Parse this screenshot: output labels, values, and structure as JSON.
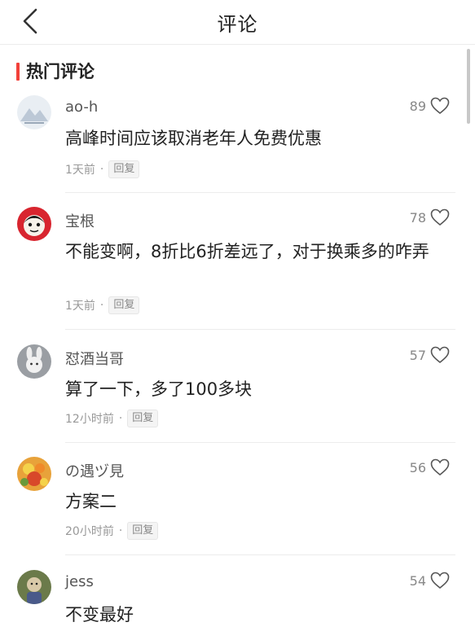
{
  "header": {
    "title": "评论"
  },
  "section": {
    "title": "热门评论"
  },
  "colors": {
    "accent": "#f2413a",
    "divider": "#ececec"
  },
  "comments": [
    {
      "user": "ao-h",
      "likes": "89",
      "text": "高峰时间应该取消老年人免费优惠",
      "time": "1天前",
      "reply": "回复",
      "avatar_icon": "mountain-avatar-icon"
    },
    {
      "user": "宝根",
      "likes": "78",
      "text": "不能变啊，8折比6折差远了，对于换乘多的咋弄",
      "time": "1天前",
      "reply": "回复",
      "avatar_icon": "cartoon-face-avatar-icon"
    },
    {
      "user": "怼酒当哥",
      "likes": "57",
      "text": "算了一下，多了100多块",
      "time": "12小时前",
      "reply": "回复",
      "avatar_icon": "rabbit-avatar-icon"
    },
    {
      "user": "の遇ヅ見",
      "likes": "56",
      "text": "方案二",
      "time": "20小时前",
      "reply": "回复",
      "avatar_icon": "flower-avatar-icon"
    },
    {
      "user": "jess",
      "likes": "54",
      "text": "不变最好",
      "time": "",
      "reply": "",
      "avatar_icon": "doll-avatar-icon"
    }
  ]
}
